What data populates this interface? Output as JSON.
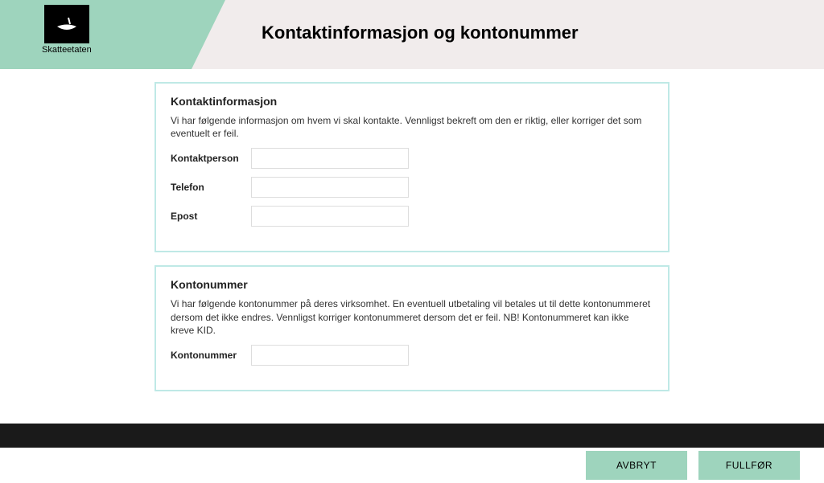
{
  "header": {
    "brand_name": "Skatteetaten",
    "page_title": "Kontaktinformasjon og kontonummer"
  },
  "sections": {
    "contact": {
      "heading": "Kontaktinformasjon",
      "description": "Vi har følgende informasjon om hvem vi skal kontakte. Vennligst bekreft om den er riktig, eller korriger det som eventuelt er feil.",
      "fields": {
        "person": {
          "label": "Kontaktperson",
          "value": ""
        },
        "phone": {
          "label": "Telefon",
          "value": ""
        },
        "email": {
          "label": "Epost",
          "value": ""
        }
      }
    },
    "account": {
      "heading": "Kontonummer",
      "description": "Vi har følgende kontonummer på deres virksomhet. En eventuell utbetaling vil betales ut til dette kontonummeret dersom det ikke endres. Vennligst korriger kontonummeret dersom det er feil. NB! Kontonummeret kan ikke kreve KID.",
      "fields": {
        "number": {
          "label": "Kontonummer",
          "value": ""
        }
      }
    }
  },
  "actions": {
    "cancel_label": "AVBRYT",
    "complete_label": "FULLFØR"
  },
  "colors": {
    "accent_green": "#9ed4bd",
    "header_light": "#f1ecec",
    "card_border": "#bfe9e6"
  }
}
